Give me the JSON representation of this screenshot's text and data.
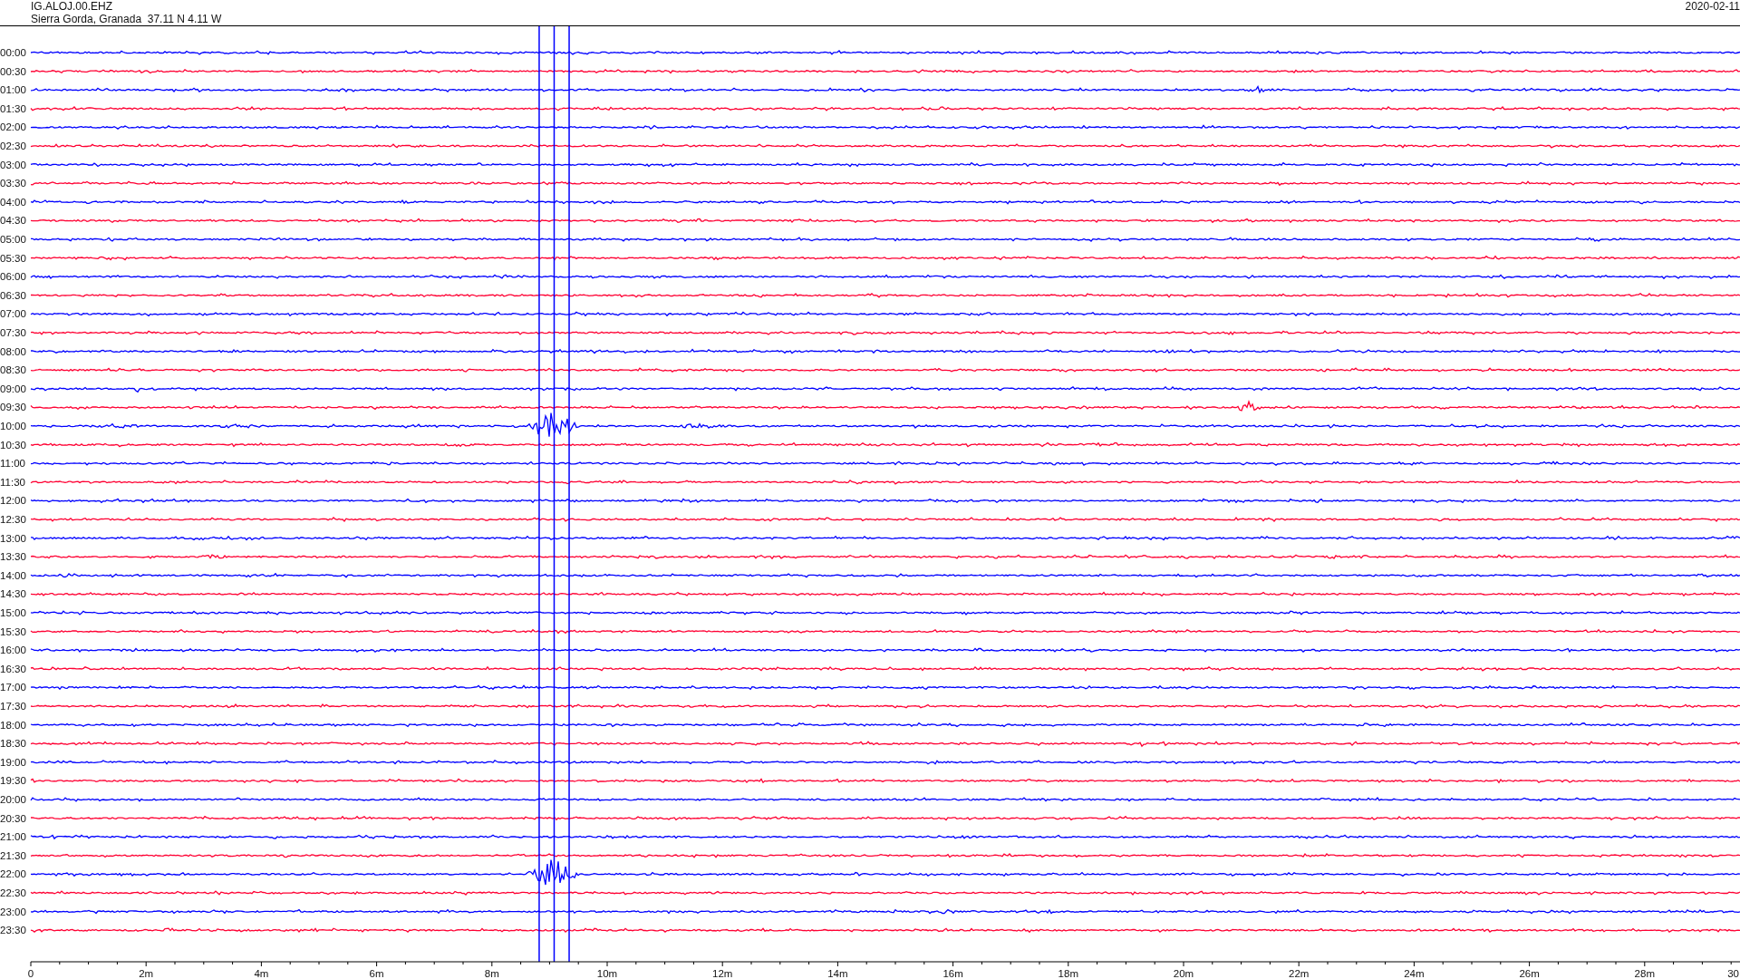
{
  "header": {
    "station": "IG.ALOJ.00.EHZ",
    "location": "Sierra Gorda, Granada  37.11 N 4.11 W",
    "date": "2020-02-11"
  },
  "rows": [
    {
      "label": "00:00",
      "color": "#0000ff"
    },
    {
      "label": "00:30",
      "color": "#ff0033"
    },
    {
      "label": "01:00",
      "color": "#0000ff"
    },
    {
      "label": "01:30",
      "color": "#ff0033"
    },
    {
      "label": "02:00",
      "color": "#0000ff"
    },
    {
      "label": "02:30",
      "color": "#ff0033"
    },
    {
      "label": "03:00",
      "color": "#0000ff"
    },
    {
      "label": "03:30",
      "color": "#ff0033"
    },
    {
      "label": "04:00",
      "color": "#0000ff"
    },
    {
      "label": "04:30",
      "color": "#ff0033"
    },
    {
      "label": "05:00",
      "color": "#0000ff"
    },
    {
      "label": "05:30",
      "color": "#ff0033"
    },
    {
      "label": "06:00",
      "color": "#0000ff"
    },
    {
      "label": "06:30",
      "color": "#ff0033"
    },
    {
      "label": "07:00",
      "color": "#0000ff"
    },
    {
      "label": "07:30",
      "color": "#ff0033"
    },
    {
      "label": "08:00",
      "color": "#0000ff"
    },
    {
      "label": "08:30",
      "color": "#ff0033"
    },
    {
      "label": "09:00",
      "color": "#0000ff"
    },
    {
      "label": "09:30",
      "color": "#ff0033"
    },
    {
      "label": "10:00",
      "color": "#0000ff"
    },
    {
      "label": "10:30",
      "color": "#ff0033"
    },
    {
      "label": "11:00",
      "color": "#0000ff"
    },
    {
      "label": "11:30",
      "color": "#ff0033"
    },
    {
      "label": "12:00",
      "color": "#0000ff"
    },
    {
      "label": "12:30",
      "color": "#ff0033"
    },
    {
      "label": "13:00",
      "color": "#0000ff"
    },
    {
      "label": "13:30",
      "color": "#ff0033"
    },
    {
      "label": "14:00",
      "color": "#0000ff"
    },
    {
      "label": "14:30",
      "color": "#ff0033"
    },
    {
      "label": "15:00",
      "color": "#0000ff"
    },
    {
      "label": "15:30",
      "color": "#ff0033"
    },
    {
      "label": "16:00",
      "color": "#0000ff"
    },
    {
      "label": "16:30",
      "color": "#ff0033"
    },
    {
      "label": "17:00",
      "color": "#0000ff"
    },
    {
      "label": "17:30",
      "color": "#ff0033"
    },
    {
      "label": "18:00",
      "color": "#0000ff"
    },
    {
      "label": "18:30",
      "color": "#ff0033"
    },
    {
      "label": "19:00",
      "color": "#0000ff"
    },
    {
      "label": "19:30",
      "color": "#ff0033"
    },
    {
      "label": "20:00",
      "color": "#0000ff"
    },
    {
      "label": "20:30",
      "color": "#ff0033"
    },
    {
      "label": "21:00",
      "color": "#0000ff"
    },
    {
      "label": "21:30",
      "color": "#ff0033"
    },
    {
      "label": "22:00",
      "color": "#0000ff"
    },
    {
      "label": "22:30",
      "color": "#ff0033"
    },
    {
      "label": "23:00",
      "color": "#0000ff"
    },
    {
      "label": "23:30",
      "color": "#ff0033"
    }
  ],
  "x_axis": {
    "ticks": [
      "0",
      "2m",
      "4m",
      "6m",
      "8m",
      "10m",
      "12m",
      "14m",
      "16m",
      "18m",
      "20m",
      "22m",
      "24m",
      "26m",
      "28m",
      "30"
    ]
  }
}
